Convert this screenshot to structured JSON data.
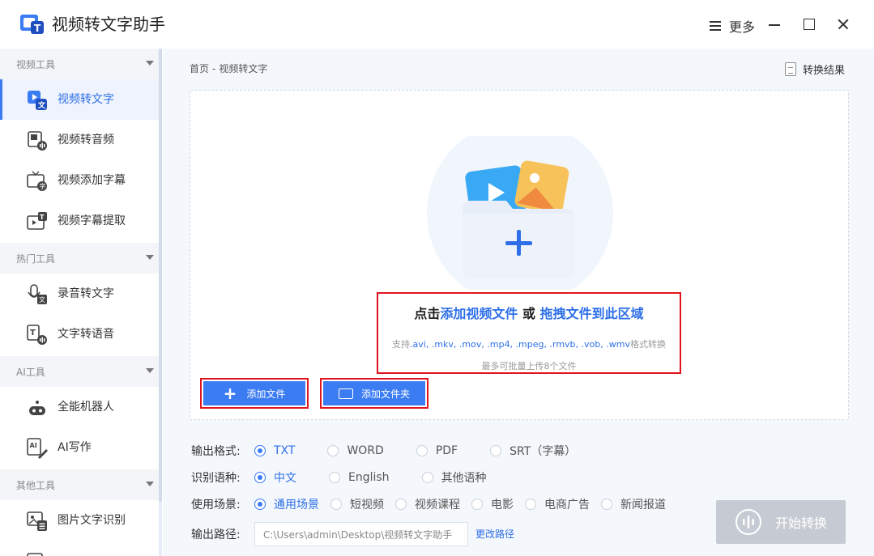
{
  "app": {
    "title": "视频转文字助手"
  },
  "window": {
    "more_label": "更多"
  },
  "sidebar": {
    "groups": [
      {
        "label": "视频工具"
      },
      {
        "label": "热门工具"
      },
      {
        "label": "AI工具"
      },
      {
        "label": "其他工具"
      }
    ],
    "items": [
      {
        "label": "视频转文字",
        "active": true
      },
      {
        "label": "视频转音频"
      },
      {
        "label": "视频添加字幕"
      },
      {
        "label": "视频字幕提取"
      },
      {
        "label": "录音转文字"
      },
      {
        "label": "文字转语音"
      },
      {
        "label": "全能机器人"
      },
      {
        "label": "AI写作"
      },
      {
        "label": "图片文字识别"
      }
    ]
  },
  "main": {
    "breadcrumb": {
      "home": "首页",
      "sep": "-",
      "current": "视频转文字"
    },
    "result_link": "转换结果",
    "drop": {
      "prefix": "点击",
      "link1": "添加视频文件",
      "or": " 或 ",
      "link2": "拖拽文件到此区域",
      "formats_prefix": "支持",
      "formats": ".avi, .mkv, .mov, .mp4, .mpeg, .rmvb, .vob, .wmv",
      "formats_suffix": "格式转换",
      "limit": "最多可批量上传8个文件"
    },
    "add_file_label": "添加文件",
    "add_folder_label": "添加文件夹",
    "output_format": {
      "label": "输出格式:",
      "options": [
        "TXT",
        "WORD",
        "PDF",
        "SRT（字幕）"
      ],
      "selected": "TXT"
    },
    "language": {
      "label": "识别语种:",
      "options": [
        "中文",
        "English",
        "其他语种"
      ],
      "selected": "中文"
    },
    "scene": {
      "label": "使用场景:",
      "options": [
        "通用场景",
        "短视频",
        "视频课程",
        "电影",
        "电商广告",
        "新闻报道"
      ],
      "selected": "通用场景"
    },
    "output_path": {
      "label": "输出路径:",
      "value": "C:\\Users\\admin\\Desktop\\视频转文字助手",
      "change_label": "更改路径"
    },
    "start_label": "开始转换"
  },
  "colors": {
    "accent": "#3b7cf3",
    "highlight_border": "#e0141e",
    "disabled": "#c6cbd3"
  }
}
